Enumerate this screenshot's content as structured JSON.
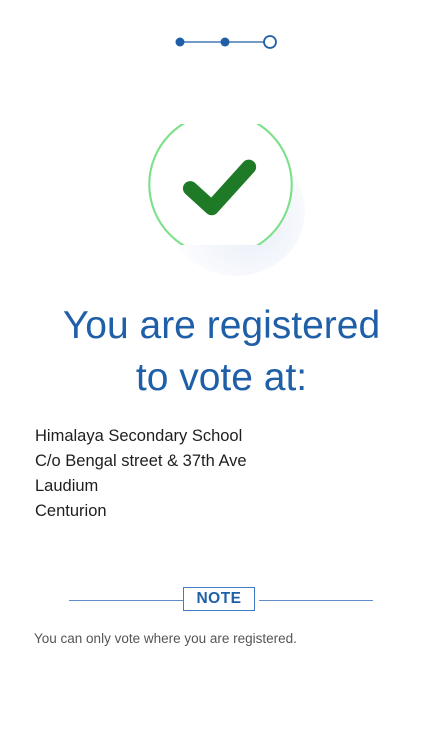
{
  "stepper": {
    "total_steps": 3,
    "current_step": 3,
    "accent_color": "#1f5fa8"
  },
  "status_icon": {
    "icon": "checkmark-icon",
    "ring_color": "#7ee08a",
    "check_color": "#1e7a26"
  },
  "headline": {
    "line1": "You are registered",
    "line2": "to vote at:"
  },
  "address": {
    "lines": [
      "Himalaya Secondary School",
      "C/o Bengal street & 37th Ave",
      "Laudium",
      "Centurion"
    ]
  },
  "note": {
    "label": "NOTE",
    "text": "You can only vote where you are registered."
  }
}
